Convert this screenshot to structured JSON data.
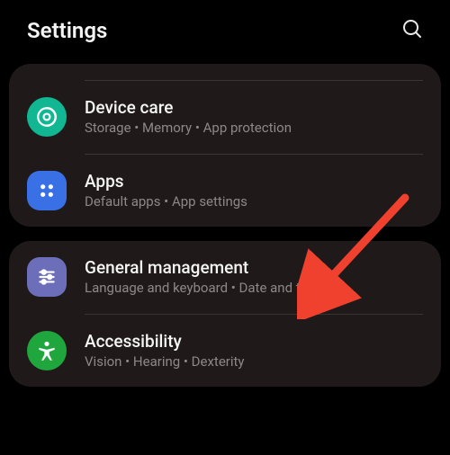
{
  "header": {
    "title": "Settings"
  },
  "cards": [
    {
      "items": [
        {
          "title": "Device care",
          "subtitle": "Storage  •  Memory  •  App protection"
        },
        {
          "title": "Apps",
          "subtitle": "Default apps  •  App settings"
        }
      ]
    },
    {
      "items": [
        {
          "title": "General management",
          "subtitle": "Language and keyboard  •  Date and time"
        },
        {
          "title": "Accessibility",
          "subtitle": "Vision  •  Hearing  •  Dexterity"
        }
      ]
    }
  ],
  "colors": {
    "device_care": "#11b693",
    "apps": "#3970e6",
    "general_management": "#6d6eb9",
    "accessibility": "#1fa63c",
    "arrow": "#f0402e"
  }
}
